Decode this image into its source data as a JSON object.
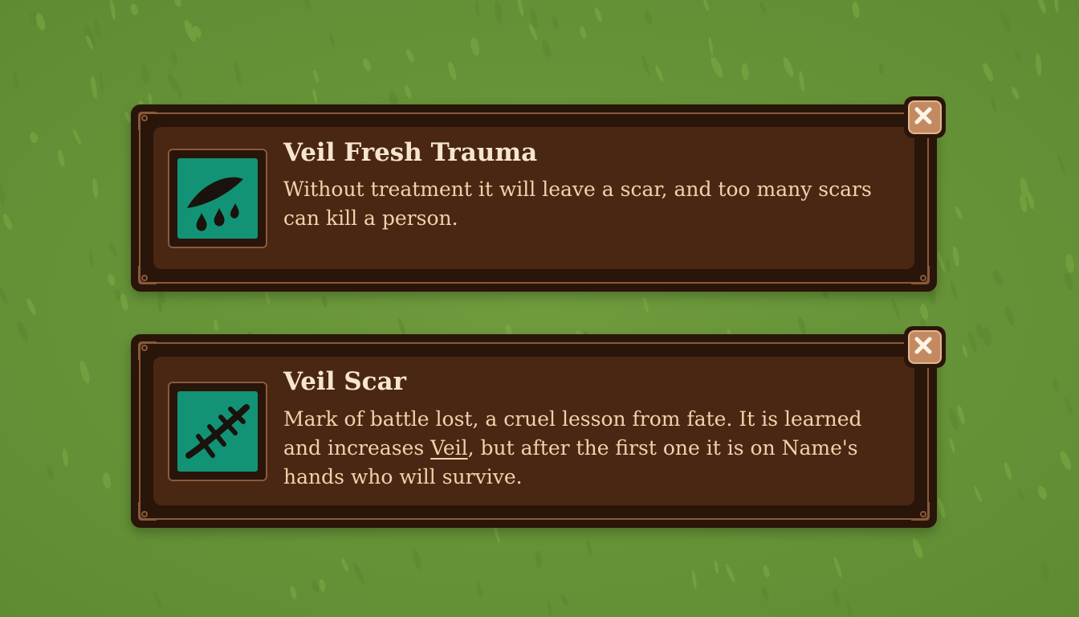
{
  "colors": {
    "grass": "#6e9a3c",
    "panel_dark": "#2a150a",
    "panel": "#4a2713",
    "trim": "#8a5a3a",
    "icon_tile": "#129375",
    "title_text": "#f7e6cf",
    "desc_text": "#f0d2aa",
    "close_button": "#c38a62"
  },
  "tooltips": [
    {
      "title": "Veil Fresh Trauma",
      "icon": "bleeding-wound-icon",
      "description": "Without treatment it will leave a scar, and too many scars can kill a person."
    },
    {
      "title": "Veil Scar",
      "icon": "stitched-scar-icon",
      "description_before": "Mark of battle lost, a cruel lesson from fate. It is learned and increases ",
      "description_keyword": "Veil",
      "description_after": ", but after the first one it is on Name's hands who will survive."
    }
  ]
}
